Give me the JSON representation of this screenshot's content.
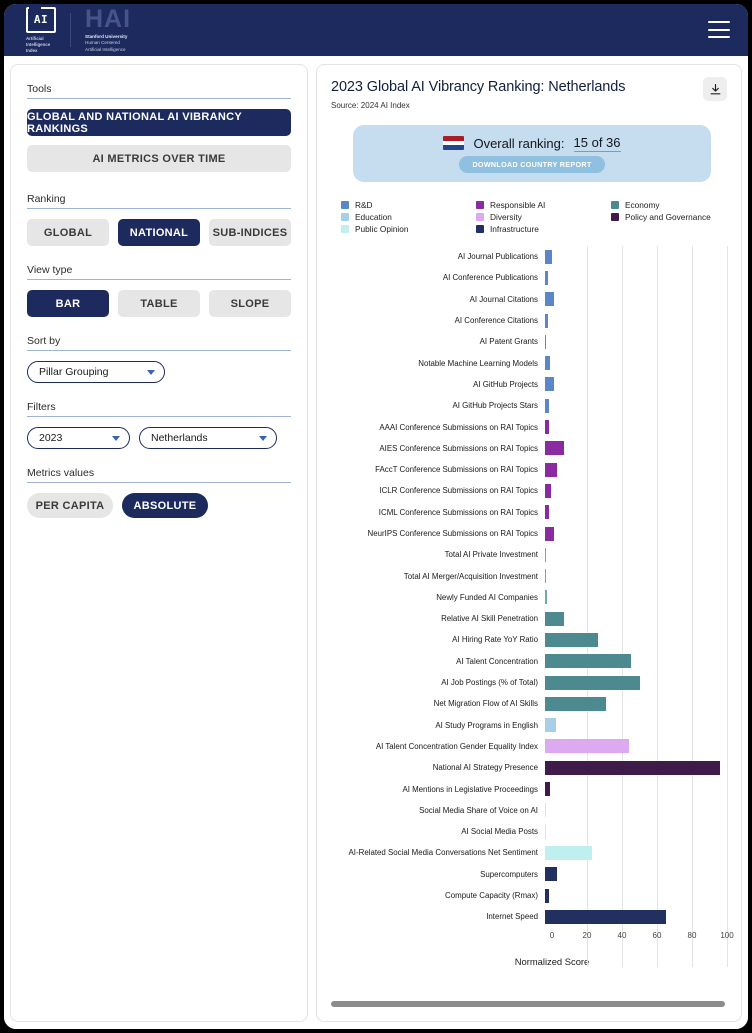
{
  "topnav": {
    "aii_logo_text": "AI",
    "aii_sub_lines": [
      "Artificial",
      "Intelligence",
      "Index"
    ],
    "hai_logo_text": "HAI",
    "hai_sub_line1": "Stanford University",
    "hai_sub_line2": "Human Centered",
    "hai_sub_line3": "Artificial Intelligence",
    "menu_icon": "hamburger-menu-icon",
    "bg_color": "#1c2a5e"
  },
  "sidebar": {
    "tools_label": "Tools",
    "tools": [
      {
        "label": "GLOBAL AND NATIONAL AI VIBRANCY RANKINGS",
        "selected": true
      },
      {
        "label": "AI METRICS OVER TIME",
        "selected": false
      }
    ],
    "ranking_label": "Ranking",
    "ranking_options": [
      {
        "label": "GLOBAL",
        "selected": false
      },
      {
        "label": "NATIONAL",
        "selected": true
      },
      {
        "label": "SUB-INDICES",
        "selected": false
      }
    ],
    "viewtype_label": "View type",
    "viewtype_options": [
      {
        "label": "BAR",
        "selected": true
      },
      {
        "label": "TABLE",
        "selected": false
      },
      {
        "label": "SLOPE",
        "selected": false
      }
    ],
    "sortby_label": "Sort by",
    "sortby_value": "Pillar Grouping",
    "filters_label": "Filters",
    "filter_year_value": "2023",
    "filter_country_value": "Netherlands",
    "metrics_label": "Metrics values",
    "metrics_options": [
      {
        "label": "PER CAPITA",
        "selected": false
      },
      {
        "label": "ABSOLUTE",
        "selected": true
      }
    ]
  },
  "main": {
    "title": "2023 Global AI Vibrancy Ranking: Netherlands",
    "source": "Source: 2024 AI Index",
    "download_icon": "download-icon",
    "rank_label": "Overall ranking:",
    "rank_value": "15 of 36",
    "rank_cta": "DOWNLOAD COUNTRY REPORT",
    "flag_colors": [
      "#ae1c28",
      "#ffffff",
      "#21468b"
    ]
  },
  "chart_data": {
    "type": "bar",
    "orientation": "horizontal",
    "title": "2023 Global AI Vibrancy Ranking: Netherlands",
    "xlabel": "Normalized Score",
    "ylabel": "",
    "xlim": [
      0,
      100
    ],
    "xticks": [
      0,
      20,
      40,
      60,
      80,
      100
    ],
    "grid": true,
    "legend_position": "top",
    "legend": [
      {
        "name": "R&D",
        "color": "#5b87c9"
      },
      {
        "name": "Education",
        "color": "#a8cfe8"
      },
      {
        "name": "Public Opinion",
        "color": "#bff0ef"
      },
      {
        "name": "Responsible AI",
        "color": "#8a2ba0"
      },
      {
        "name": "Diversity",
        "color": "#ddaaf2"
      },
      {
        "name": "Infrastructure",
        "color": "#22305f"
      },
      {
        "name": "Economy",
        "color": "#4d8a8f"
      },
      {
        "name": "Policy and Governance",
        "color": "#3e1b48"
      }
    ],
    "categories": [
      "AI Journal Publications",
      "AI Conference Publications",
      "AI Journal Citations",
      "AI Conference Citations",
      "AI Patent Grants",
      "Notable Machine Learning Models",
      "AI GitHub Projects",
      "AI GitHub Projects Stars",
      "AAAI Conference Submissions on RAI Topics",
      "AIES Conference Submissions on RAI Topics",
      "FAccT Conference Submissions on RAI Topics",
      "ICLR Conference Submissions on RAI Topics",
      "ICML Conference Submissions on RAI Topics",
      "NeurIPS Conference Submissions on RAI Topics",
      "Total AI Private Investment",
      "Total AI Merger/Acquisition Investment",
      "Newly Funded AI Companies",
      "Relative AI Skill Penetration",
      "AI Hiring Rate YoY Ratio",
      "AI Talent Concentration",
      "AI Job Postings (% of Total)",
      "Net Migration Flow of AI Skills",
      "AI Study Programs in English",
      "AI Talent Concentration Gender Equality Index",
      "National AI Strategy Presence",
      "AI Mentions in Legislative Proceedings",
      "Social Media Share of Voice on AI",
      "AI Social Media Posts",
      "AI-Related Social Media Conversations Net Sentiment",
      "Supercomputers",
      "Compute Capacity (Rmax)",
      "Internet Speed"
    ],
    "values": [
      4.0,
      1.5,
      5.0,
      1.5,
      0.3,
      3.0,
      5.0,
      2.0,
      2.5,
      11.0,
      7.0,
      3.5,
      2.5,
      5.0,
      0.8,
      0.0,
      1.0,
      11.0,
      30.0,
      49.0,
      54.0,
      35.0,
      6.0,
      48.0,
      100.0,
      3.0,
      0.6,
      0.6,
      27.0,
      7.0,
      2.0,
      69.0
    ],
    "colors": [
      "#5b87c9",
      "#5b87c9",
      "#5b87c9",
      "#5b87c9",
      "#5b87c9",
      "#5b87c9",
      "#5b87c9",
      "#5b87c9",
      "#8a2ba0",
      "#8a2ba0",
      "#8a2ba0",
      "#8a2ba0",
      "#8a2ba0",
      "#8a2ba0",
      "#6fa8ad",
      "#6fa8ad",
      "#6fa8ad",
      "#4d8a8f",
      "#4d8a8f",
      "#4d8a8f",
      "#4d8a8f",
      "#4d8a8f",
      "#a8cfe8",
      "#ddaaf2",
      "#3e1b48",
      "#3e1b48",
      "#bff0ef",
      "#bff0ef",
      "#bff0ef",
      "#22305f",
      "#22305f",
      "#22305f"
    ]
  }
}
